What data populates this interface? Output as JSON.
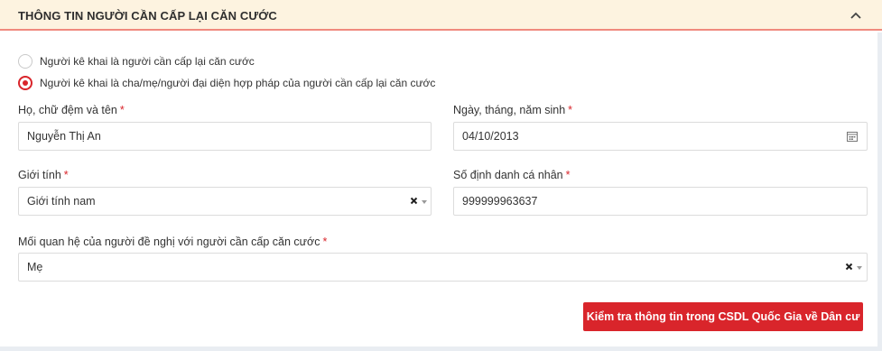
{
  "panel": {
    "title": "THÔNG TIN NGƯỜI CẦN CẤP LẠI CĂN CƯỚC"
  },
  "declarant_type": {
    "options": [
      {
        "label": "Người kê khai là người cần cấp lại căn cước",
        "selected": false
      },
      {
        "label": "Người kê khai là cha/mẹ/người đại diện hợp pháp của người cần cấp lại căn cước",
        "selected": true
      }
    ]
  },
  "form": {
    "full_name": {
      "label": "Họ, chữ đệm và tên",
      "required_mark": "*",
      "value": "Nguyễn Thị An"
    },
    "birth_date": {
      "label": "Ngày, tháng, năm sinh",
      "required_mark": "*",
      "value": "04/10/2013"
    },
    "gender": {
      "label": "Giới tính",
      "required_mark": "*",
      "value": "Giới tính nam"
    },
    "personal_id": {
      "label": "Số định danh cá nhân",
      "required_mark": "*",
      "value": "999999963637"
    },
    "relationship": {
      "label": "Mối quan hệ của người đề nghị với người cần cấp căn cước",
      "required_mark": "*",
      "value": "Mẹ"
    }
  },
  "actions": {
    "check_button": "Kiểm tra thông tin trong CSDL Quốc Gia về Dân cư"
  },
  "colors": {
    "accent": "#d9252b",
    "header_bg": "#fdf3e0",
    "header_border": "#f08a7e"
  },
  "icons": {
    "collapse": "chevron-up-icon",
    "calendar": "calendar-icon",
    "clear": "close-icon",
    "dropdown": "caret-down-icon"
  }
}
